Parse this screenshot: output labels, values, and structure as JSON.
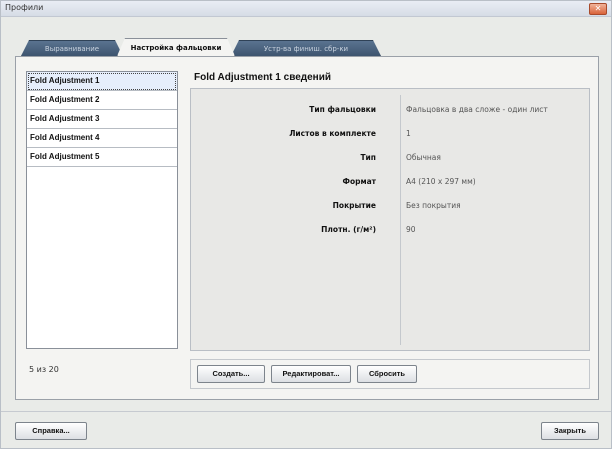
{
  "window": {
    "title": "Профили",
    "close_glyph": "✕"
  },
  "tabs": [
    {
      "label": "Выравнивание"
    },
    {
      "label": "Настройка фальцовки"
    },
    {
      "label": "Устр-ва финиш. сбр-ки"
    }
  ],
  "list": {
    "items": [
      "Fold Adjustment 1",
      "Fold Adjustment 2",
      "Fold Adjustment 3",
      "Fold Adjustment 4",
      "Fold Adjustment 5"
    ],
    "selected_index": 0,
    "count_text": "5 из 20"
  },
  "details": {
    "title": "Fold Adjustment 1 сведений",
    "rows": [
      {
        "label": "Тип фальцовки",
        "value": "Фальцовка в два сложе - один лист"
      },
      {
        "label": "Листов в комплекте",
        "value": "1"
      },
      {
        "label": "Тип",
        "value": "Обычная"
      },
      {
        "label": "Формат",
        "value": "A4 (210 x 297 мм)"
      },
      {
        "label": "Покрытие",
        "value": "Без покрытия"
      },
      {
        "label": "Плотн. (г/м²)",
        "value": "90"
      }
    ]
  },
  "actions": {
    "create_label": "Создать...",
    "edit_label": "Редактироват...",
    "reset_label": "Сбросить"
  },
  "footer": {
    "help_label": "Справка...",
    "close_label": "Закрыть"
  },
  "colors": {
    "tab_inactive": "#4c6580",
    "selected_row": "#e6eefb",
    "close_button": "#d9633a"
  }
}
